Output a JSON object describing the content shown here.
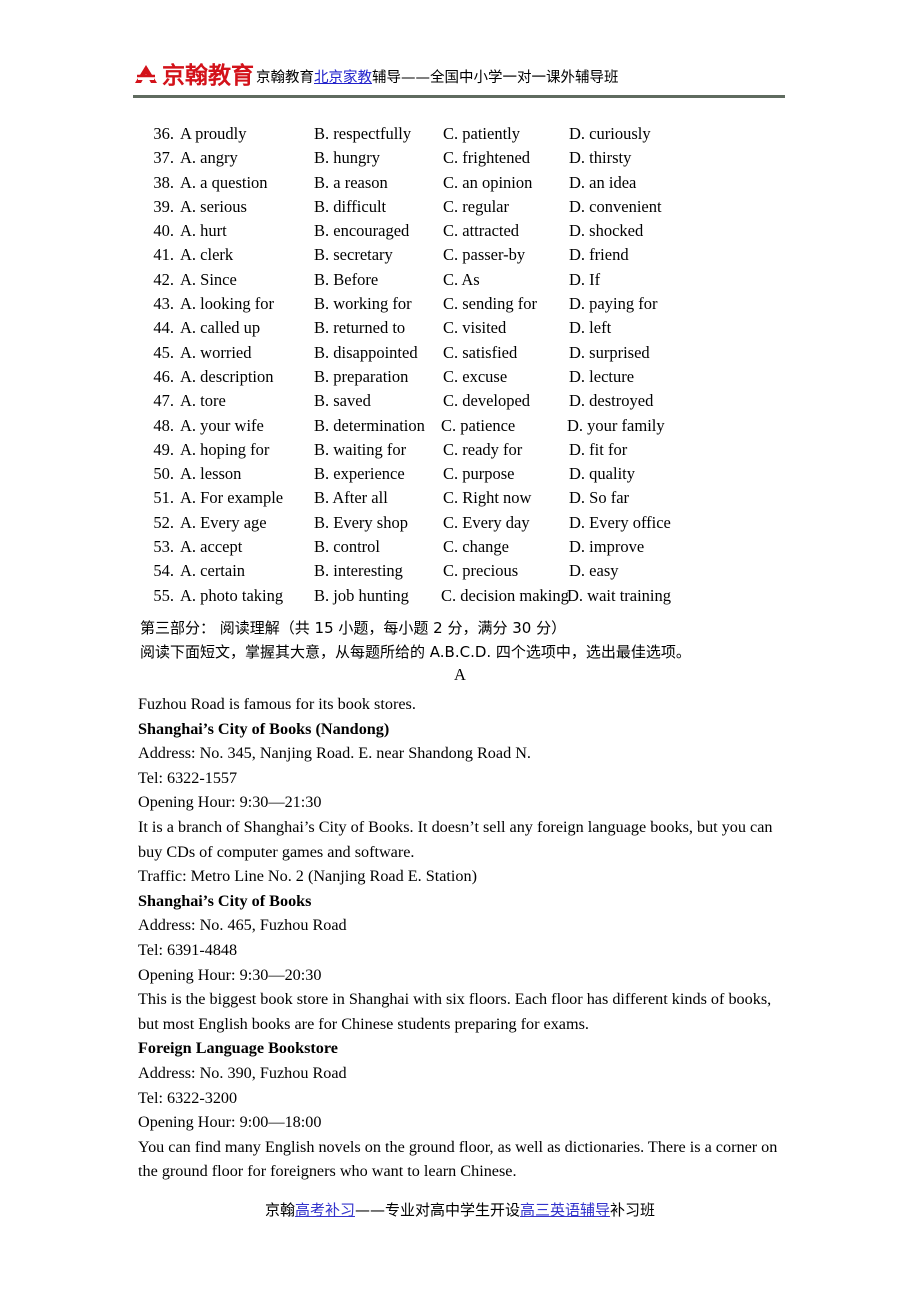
{
  "header": {
    "logo_alt": "jinghan-education-logo",
    "logo_text": "京翰教育",
    "logo_color": "#d3121a",
    "tagline_pre": "京翰教育",
    "tagline_link": "北京家教",
    "tagline_post": "辅导——全国中小学一对一课外辅导班",
    "link_color": "#2222cc",
    "rule_color": "#5f6b5f"
  },
  "questions": [
    {
      "num": "36.",
      "a": "A   proudly",
      "b": "B. respectfully",
      "c": "C. patiently",
      "d": "D. curiously"
    },
    {
      "num": "37.",
      "a": "A. angry",
      "b": "B. hungry",
      "c": "C. frightened",
      "d": "D. thirsty"
    },
    {
      "num": "38.",
      "a": "A. a question",
      "b": "B. a reason",
      "c": "C. an opinion",
      "d": "D. an idea"
    },
    {
      "num": "39.",
      "a": "A. serious",
      "b": "B. difficult",
      "c": "C. regular",
      "d": "D. convenient"
    },
    {
      "num": "40.",
      "a": "A. hurt",
      "b": "B. encouraged",
      "c": "C. attracted",
      "d": "D. shocked"
    },
    {
      "num": "41.",
      "a": "A. clerk",
      "b": "B. secretary",
      "c": "C. passer-by",
      "d": "D. friend"
    },
    {
      "num": "42.",
      "a": "A. Since",
      "b": "B. Before",
      "c": "C. As",
      "d": "D. If"
    },
    {
      "num": "43.",
      "a": "A. looking for",
      "b": "B. working for",
      "c": "C. sending for",
      "d": "D. paying for"
    },
    {
      "num": "44.",
      "a": "A. called up",
      "b": "B. returned to",
      "c": "C. visited",
      "d": "D. left"
    },
    {
      "num": "45.",
      "a": "A. worried",
      "b": "B. disappointed",
      "c": "C. satisfied",
      "d": "D. surprised"
    },
    {
      "num": "46.",
      "a": "A. description",
      "b": "B. preparation",
      "c": "C. excuse",
      "d": "D. lecture"
    },
    {
      "num": "47.",
      "a": "A. tore",
      "b": "B. saved",
      "c": "C. developed",
      "d": "D. destroyed"
    },
    {
      "num": "48.",
      "a": "A. your wife",
      "b": "B. determination",
      "c": "C. patience",
      "d": "D. your family"
    },
    {
      "num": "49.",
      "a": "A. hoping for",
      "b": "B. waiting for",
      "c": "C. ready for",
      "d": "D. fit for"
    },
    {
      "num": "50.",
      "a": "A. lesson",
      "b": "B. experience",
      "c": "C. purpose",
      "d": "D. quality"
    },
    {
      "num": "51.",
      "a": "A. For example",
      "b": "B. After all",
      "c": "C. Right now",
      "d": "D. So far"
    },
    {
      "num": "52.",
      "a": "A. Every age",
      "b": "B. Every shop",
      "c": "C. Every day",
      "d": "D. Every office"
    },
    {
      "num": "53.",
      "a": "A. accept",
      "b": "B. control",
      "c": "C. change",
      "d": "D. improve"
    },
    {
      "num": "54.",
      "a": "A. certain",
      "b": "B. interesting",
      "c": "C. precious",
      "d": "D. easy"
    },
    {
      "num": "55.",
      "a": "A. photo taking",
      "b": "B. job hunting",
      "c": "C. decision making",
      "d": "D. wait training"
    }
  ],
  "section": {
    "part_title": "第三部分：  阅读理解（共 15 小题，每小题 2 分，满分 30 分）",
    "instruction": "阅读下面短文，掌握其大意，从每题所给的 A.B.C.D. 四个选项中，选出最佳选项。",
    "passage_letter": "A"
  },
  "passage": {
    "intro": "Fuzhou Road is famous for its book stores.",
    "store1": {
      "name": "Shanghai’s City of Books (Nandong)",
      "address": "Address: No. 345, Nanjing Road. E. near Shandong Road N.",
      "tel": "Tel: 6322-1557",
      "hours": "Opening Hour: 9:30—21:30",
      "desc": "It is a branch of Shanghai’s City of Books. It doesn’t sell any foreign language books, but you can buy CDs of computer games and software.",
      "traffic": "Traffic: Metro Line No. 2 (Nanjing Road E. Station)"
    },
    "store2": {
      "name": "Shanghai’s City of Books",
      "address": "Address: No. 465, Fuzhou Road",
      "tel": "Tel: 6391-4848",
      "hours": "Opening Hour: 9:30—20:30",
      "desc": "This is the biggest book store in Shanghai with six floors. Each floor has different kinds of books, but most English books are for Chinese students preparing for exams."
    },
    "store3": {
      "name": "Foreign Language Bookstore",
      "address": "Address: No. 390, Fuzhou Road",
      "tel": "Tel: 6322-3200",
      "hours": "Opening Hour: 9:00—18:00",
      "desc": "You can find many English novels on the ground floor, as well as dictionaries. There is a corner on the ground floor for foreigners who want to learn Chinese."
    }
  },
  "footer": {
    "pre": "京翰",
    "link1": "高考补习",
    "mid": "——专业对高中学生开设",
    "link2": "高三英语辅导",
    "post": "补习班",
    "link_color": "#3333cc"
  }
}
